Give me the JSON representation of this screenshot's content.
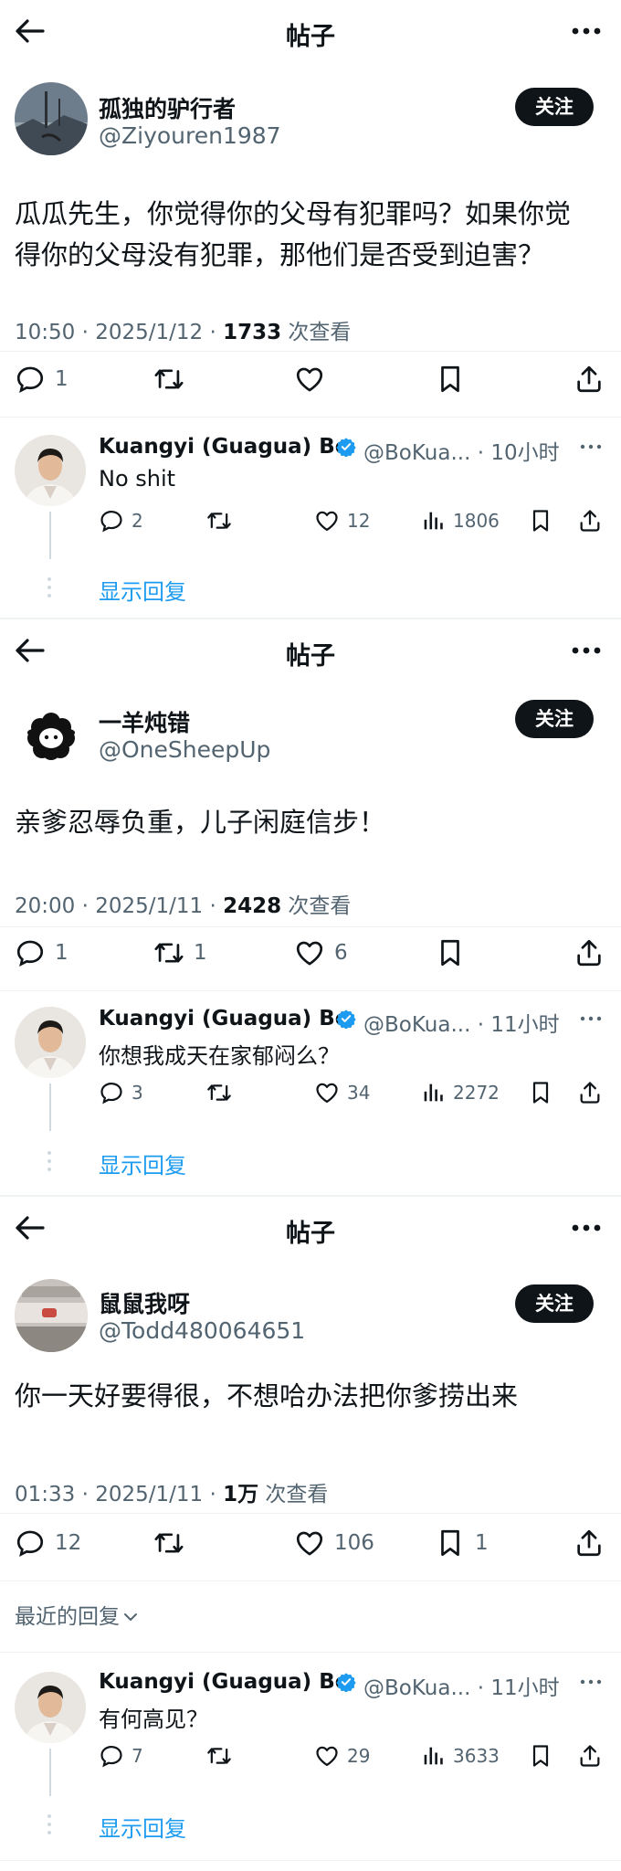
{
  "header_title": "帖子",
  "follow_label": "关注",
  "show_replies": "显示回复",
  "views_suffix": "次查看",
  "posts": [
    {
      "author_name": "孤独的驴行者",
      "author_handle": "@Ziyouren1987",
      "text_lines": [
        "瓜瓜先生，你觉得你的父母有犯罪吗？如果你觉",
        "得你的父母没有犯罪，那他们是否受到迫害？"
      ],
      "time": "10:50 · 2025/1/12 · ",
      "views": "1733",
      "counts": {
        "reply": "1",
        "retweet": "",
        "like": "",
        "bookmark": ""
      },
      "reply": {
        "name": "Kuangyi (Guagua) Bo",
        "handle": "@BoKua... · 10小时",
        "text": "No shit",
        "replies": "2",
        "retweets": "",
        "likes": "12",
        "views": "1806"
      }
    },
    {
      "author_name": "一羊炖错",
      "author_handle": "@OneSheepUp",
      "text_lines": [
        "亲爹忍辱负重，儿子闲庭信步！"
      ],
      "time": "20:00 · 2025/1/11 · ",
      "views": "2428",
      "counts": {
        "reply": "1",
        "retweet": "1",
        "like": "6",
        "bookmark": ""
      },
      "reply": {
        "name": "Kuangyi (Guagua) Bo",
        "handle": "@BoKua... · 11小时",
        "text": "你想我成天在家郁闷么？",
        "replies": "3",
        "retweets": "",
        "likes": "34",
        "views": "2272"
      }
    },
    {
      "author_name": "鼠鼠我呀",
      "author_handle": "@Todd480064651",
      "text_lines": [
        "你一天好要得很，不想哈办法把你爹捞出来"
      ],
      "time": "01:33 · 2025/1/11 · ",
      "views": "1万",
      "counts": {
        "reply": "12",
        "retweet": "",
        "like": "106",
        "bookmark": "1"
      },
      "recent_label": "最近的回复",
      "reply": {
        "name": "Kuangyi (Guagua) Bo",
        "handle": "@BoKua... · 11小时",
        "text": "有何高见？",
        "replies": "7",
        "retweets": "",
        "likes": "29",
        "views": "3633"
      }
    }
  ],
  "icons": [
    "back-arrow-icon",
    "more-icon",
    "reply-icon",
    "retweet-icon",
    "like-icon",
    "bookmark-icon",
    "share-icon",
    "views-icon",
    "verified-icon",
    "chevron-down-icon"
  ],
  "colors": {
    "accent": "#1d9bf0",
    "text": "#0f1419",
    "muted": "#536471",
    "follow_bg": "#0f1419"
  }
}
